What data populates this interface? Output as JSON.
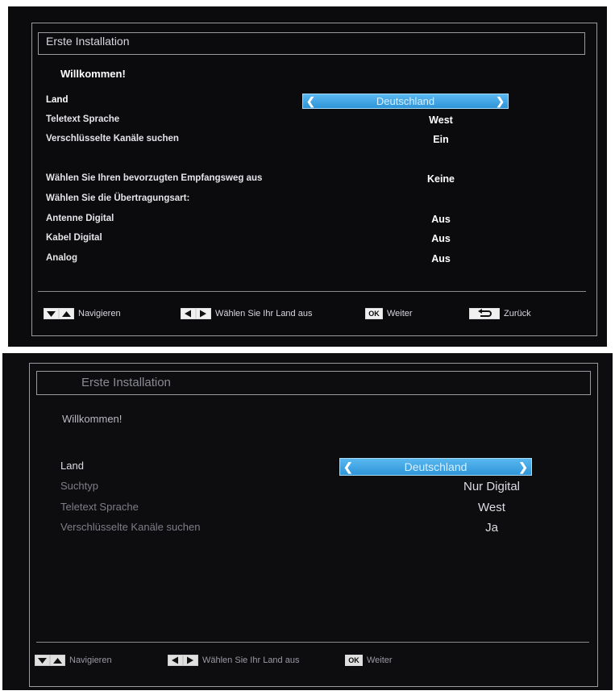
{
  "screen1": {
    "title": "Erste Installation",
    "welcome": "Willkommen!",
    "selected": {
      "label": "Land",
      "value": "Deutschland"
    },
    "rows": [
      {
        "label": "Teletext Sprache",
        "value": "West"
      },
      {
        "label": "Verschlüsselte Kanäle suchen",
        "value": "Ein"
      },
      {
        "label": "Wählen Sie Ihren bevorzugten Empfangsweg aus",
        "value": "Keine"
      },
      {
        "label": "Wählen Sie die Übertragungsart:",
        "value": ""
      },
      {
        "label": "Antenne Digital",
        "value": "Aus"
      },
      {
        "label": "Kabel Digital",
        "value": "Aus"
      },
      {
        "label": "Analog",
        "value": "Aus"
      }
    ],
    "footer": {
      "navigate": "Navigieren",
      "select_country": "Wählen Sie Ihr Land aus",
      "ok_key": "OK",
      "next": "Weiter",
      "back": "Zurück"
    }
  },
  "screen2": {
    "title": "Erste Installation",
    "welcome": "Willkommen!",
    "selected": {
      "label": "Land",
      "value": "Deutschland"
    },
    "rows": [
      {
        "label": "Suchtyp",
        "value": "Nur Digital"
      },
      {
        "label": "Teletext Sprache",
        "value": "West"
      },
      {
        "label": "Verschlüsselte Kanäle suchen",
        "value": "Ja"
      }
    ],
    "footer": {
      "navigate": "Navigieren",
      "select_country": "Wählen Sie Ihr Land aus",
      "ok_key": "OK",
      "next": "Weiter"
    }
  },
  "icons": {
    "up_down": "up-down-arrow-keys-icon",
    "left_right": "left-right-arrow-keys-icon",
    "ok": "ok-key-icon",
    "back": "back-return-icon",
    "chevron_left": "chevron-left-icon",
    "chevron_right": "chevron-right-icon"
  },
  "colors": {
    "background": "#0b0b0e",
    "selection": "#3ea6e4",
    "text": "#e6e6ea",
    "dim_text": "#8a8a94"
  }
}
